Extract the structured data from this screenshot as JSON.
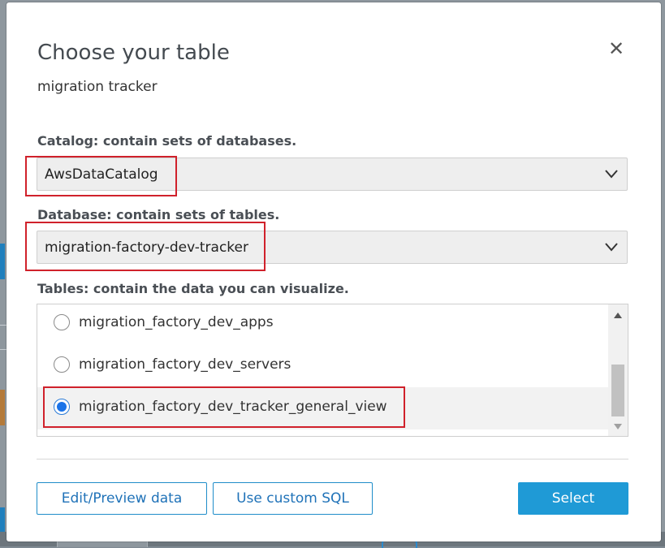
{
  "dialog": {
    "title": "Choose your table",
    "subtitle": "migration tracker",
    "close_glyph": "✕"
  },
  "catalog": {
    "label": "Catalog: contain sets of databases.",
    "value": "AwsDataCatalog"
  },
  "database": {
    "label": "Database: contain sets of tables.",
    "value": "migration-factory-dev-tracker"
  },
  "tables": {
    "label": "Tables: contain the data you can visualize.",
    "items": [
      {
        "name": "migration_factory_dev_apps",
        "selected": false
      },
      {
        "name": "migration_factory_dev_servers",
        "selected": false
      },
      {
        "name": "migration_factory_dev_tracker_general_view",
        "selected": true
      }
    ]
  },
  "buttons": {
    "edit_preview": "Edit/Preview data",
    "custom_sql": "Use custom SQL",
    "select": "Select"
  },
  "colors": {
    "primary": "#1f9ad6",
    "highlight": "#d0212b",
    "radio_selected": "#1a73e8"
  },
  "icons": {
    "close": "close-icon",
    "dropdown": "chevron-down-icon"
  }
}
